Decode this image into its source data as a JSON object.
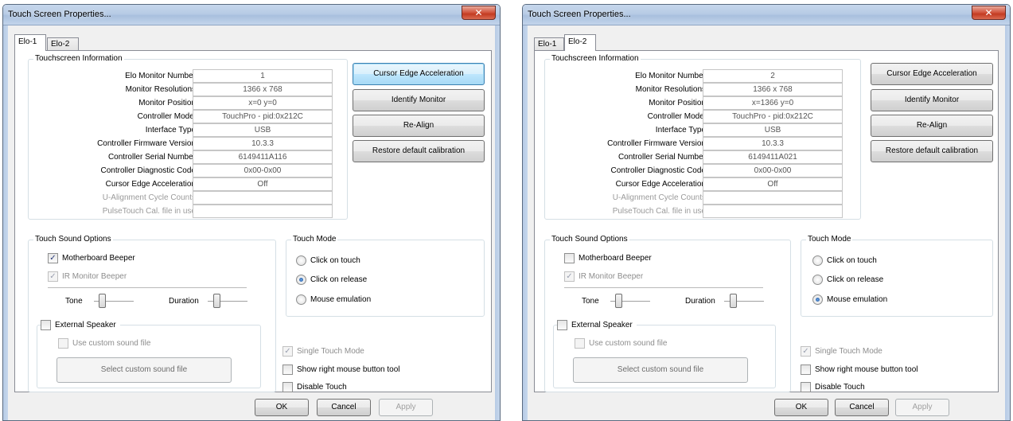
{
  "title": "Touch Screen Properties...",
  "close_glyph": "✕",
  "tabs": [
    "Elo-1",
    "Elo-2"
  ],
  "labels": {
    "touchscreen_info": "Touchscreen Information",
    "elo_monitor_number": "Elo Monitor Number",
    "monitor_resolutions": "Monitor Resolutions",
    "monitor_position": "Monitor Position",
    "controller_model": "Controller Model",
    "interface_type": "Interface Type",
    "controller_firmware_version": "Controller Firmware Version",
    "controller_serial_number": "Controller Serial Number",
    "controller_diagnostic_code": "Controller Diagnostic Code",
    "cursor_edge_acceleration": "Cursor Edge Acceleration",
    "u_alignment_cycle_counts": "U-Alignment Cycle Counts",
    "pulsetouch_cal_file": "PulseTouch Cal. file in use",
    "touch_sound_options": "Touch Sound Options",
    "motherboard_beeper": "Motherboard Beeper",
    "ir_monitor_beeper": "IR Monitor Beeper",
    "tone": "Tone",
    "duration": "Duration",
    "external_speaker": "External Speaker",
    "use_custom_sound_file": "Use custom sound file",
    "select_custom_sound_file": "Select custom sound file",
    "touch_mode": "Touch Mode",
    "click_on_touch": "Click on touch",
    "click_on_release": "Click on release",
    "mouse_emulation": "Mouse emulation",
    "single_touch_mode": "Single Touch Mode",
    "show_right_mouse_button_tool": "Show right mouse button tool",
    "disable_touch": "Disable Touch"
  },
  "buttons": {
    "cursor_edge_acceleration": "Cursor Edge Acceleration",
    "identify_monitor": "Identify Monitor",
    "re_align": "Re-Align",
    "restore_default_calibration": "Restore default calibration",
    "ok": "OK",
    "cancel": "Cancel",
    "apply": "Apply"
  },
  "windows": [
    {
      "active_tab": "Elo-1",
      "values": {
        "elo_monitor_number": "1",
        "monitor_resolutions": "1366 x 768",
        "monitor_position": "x=0  y=0",
        "controller_model": "TouchPro - pid:0x212C",
        "interface_type": "USB",
        "controller_firmware_version": "10.3.3",
        "controller_serial_number": "6149411A116",
        "controller_diagnostic_code": "0x00-0x00",
        "cursor_edge_acceleration": "Off",
        "u_alignment_cycle_counts": "",
        "pulsetouch_cal_file": ""
      },
      "motherboard_beeper": true,
      "ir_monitor_beeper": true,
      "external_speaker": false,
      "use_custom_sound_file": false,
      "touch_mode": "click_on_release",
      "single_touch_mode": true,
      "show_right_mouse_button_tool": false,
      "disable_touch": false
    },
    {
      "active_tab": "Elo-2",
      "values": {
        "elo_monitor_number": "2",
        "monitor_resolutions": "1366 x 768",
        "monitor_position": "x=1366  y=0",
        "controller_model": "TouchPro - pid:0x212C",
        "interface_type": "USB",
        "controller_firmware_version": "10.3.3",
        "controller_serial_number": "6149411A021",
        "controller_diagnostic_code": "0x00-0x00",
        "cursor_edge_acceleration": "Off",
        "u_alignment_cycle_counts": "",
        "pulsetouch_cal_file": ""
      },
      "motherboard_beeper": false,
      "ir_monitor_beeper": true,
      "external_speaker": false,
      "use_custom_sound_file": false,
      "touch_mode": "mouse_emulation",
      "single_touch_mode": true,
      "show_right_mouse_button_tool": false,
      "disable_touch": false
    }
  ],
  "colors": {
    "dialog_bg": "#f0f0f0",
    "focus_button_border": "#3c7fb1",
    "close_button": "#c23b21"
  }
}
